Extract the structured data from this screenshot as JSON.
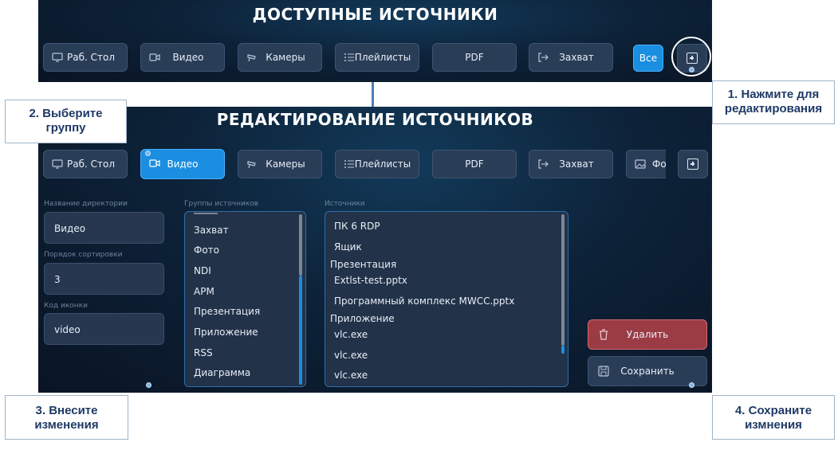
{
  "top_panel": {
    "title": "ДОСТУПНЫЕ ИСТОЧНИКИ",
    "buttons": [
      {
        "label": "Раб. Стол",
        "icon": "monitor-icon"
      },
      {
        "label": "Видео",
        "icon": "video-camera-icon"
      },
      {
        "label": "Камеры",
        "icon": "cctv-camera-icon"
      },
      {
        "label": "Плейлисты",
        "icon": "list-icon"
      },
      {
        "label": "PDF",
        "icon": ""
      },
      {
        "label": "Захват",
        "icon": "capture-arrow-icon"
      },
      {
        "label": "Все",
        "icon": ""
      }
    ],
    "add_icon": "plus-square-icon"
  },
  "edit_panel": {
    "title": "РЕДАКТИРОВАНИЕ ИСТОЧНИКОВ",
    "buttons": [
      {
        "label": "Раб. Стол",
        "icon": "monitor-icon"
      },
      {
        "label": "Видео",
        "icon": "video-camera-icon"
      },
      {
        "label": "Камеры",
        "icon": "cctv-camera-icon"
      },
      {
        "label": "Плейлисты",
        "icon": "list-icon"
      },
      {
        "label": "PDF",
        "icon": ""
      },
      {
        "label": "Захват",
        "icon": "capture-arrow-icon"
      },
      {
        "label": "Фо",
        "icon": "image-icon"
      }
    ],
    "directory_name": {
      "label": "Название директории",
      "value": "Видео"
    },
    "sort_order": {
      "label": "Порядок сортировки",
      "value": "3"
    },
    "icon_code": {
      "label": "Код иконки",
      "value": "video"
    },
    "groups": {
      "label": "Группы источников",
      "items": [
        "Захват",
        "Фото",
        "NDI",
        "АРМ",
        "Презентация",
        "Приложение",
        "RSS",
        "Диаграмма"
      ]
    },
    "sources": {
      "label": "Источники",
      "items": [
        {
          "text": "ПК 6 RDP",
          "type": "item"
        },
        {
          "text": "Ящик",
          "type": "item"
        },
        {
          "text": "Презентация",
          "type": "header"
        },
        {
          "text": "Extlst-test.pptx",
          "type": "item"
        },
        {
          "text": "Программный комплекс MWCC.pptx",
          "type": "item"
        },
        {
          "text": "Приложение",
          "type": "header"
        },
        {
          "text": "vlc.exe",
          "type": "item"
        },
        {
          "text": "vlc.exe",
          "type": "item"
        },
        {
          "text": "vlc.exe",
          "type": "item"
        }
      ]
    },
    "delete_label": "Удалить",
    "save_label": "Сохранить"
  },
  "callouts": {
    "step1": [
      "1. Нажмите для",
      "редактирования"
    ],
    "step2": [
      "2. Выберите",
      "группу"
    ],
    "step3": [
      "3. Внесите",
      "изменения"
    ],
    "step4": [
      "4. Сохраните",
      "измнения"
    ]
  },
  "colors": {
    "accent": "#1a8ee0",
    "danger": "#b5474f",
    "callout_text": "#1f3a66"
  }
}
